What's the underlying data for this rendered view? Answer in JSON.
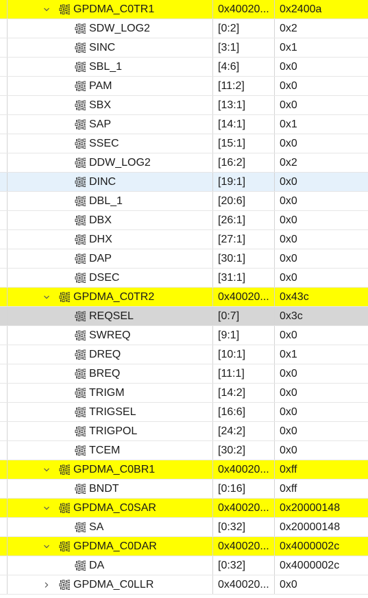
{
  "rows": [
    {
      "type": "reg",
      "name": "GPDMA_C0TR1",
      "addr": "0x40020...",
      "value": "0x2400a",
      "expanded": true,
      "hl": "yellow"
    },
    {
      "type": "field",
      "name": "SDW_LOG2",
      "bits": "[0:2]",
      "value": "0x2"
    },
    {
      "type": "field",
      "name": "SINC",
      "bits": "[3:1]",
      "value": "0x1"
    },
    {
      "type": "field",
      "name": "SBL_1",
      "bits": "[4:6]",
      "value": "0x0"
    },
    {
      "type": "field",
      "name": "PAM",
      "bits": "[11:2]",
      "value": "0x0"
    },
    {
      "type": "field",
      "name": "SBX",
      "bits": "[13:1]",
      "value": "0x0"
    },
    {
      "type": "field",
      "name": "SAP",
      "bits": "[14:1]",
      "value": "0x1"
    },
    {
      "type": "field",
      "name": "SSEC",
      "bits": "[15:1]",
      "value": "0x0"
    },
    {
      "type": "field",
      "name": "DDW_LOG2",
      "bits": "[16:2]",
      "value": "0x2"
    },
    {
      "type": "field",
      "name": "DINC",
      "bits": "[19:1]",
      "value": "0x0",
      "hl": "blue"
    },
    {
      "type": "field",
      "name": "DBL_1",
      "bits": "[20:6]",
      "value": "0x0"
    },
    {
      "type": "field",
      "name": "DBX",
      "bits": "[26:1]",
      "value": "0x0"
    },
    {
      "type": "field",
      "name": "DHX",
      "bits": "[27:1]",
      "value": "0x0"
    },
    {
      "type": "field",
      "name": "DAP",
      "bits": "[30:1]",
      "value": "0x0"
    },
    {
      "type": "field",
      "name": "DSEC",
      "bits": "[31:1]",
      "value": "0x0"
    },
    {
      "type": "reg",
      "name": "GPDMA_C0TR2",
      "addr": "0x40020...",
      "value": "0x43c",
      "expanded": true,
      "hl": "yellow"
    },
    {
      "type": "field",
      "name": "REQSEL",
      "bits": "[0:7]",
      "value": "0x3c",
      "hl": "grey"
    },
    {
      "type": "field",
      "name": "SWREQ",
      "bits": "[9:1]",
      "value": "0x0"
    },
    {
      "type": "field",
      "name": "DREQ",
      "bits": "[10:1]",
      "value": "0x1"
    },
    {
      "type": "field",
      "name": "BREQ",
      "bits": "[11:1]",
      "value": "0x0"
    },
    {
      "type": "field",
      "name": "TRIGM",
      "bits": "[14:2]",
      "value": "0x0"
    },
    {
      "type": "field",
      "name": "TRIGSEL",
      "bits": "[16:6]",
      "value": "0x0"
    },
    {
      "type": "field",
      "name": "TRIGPOL",
      "bits": "[24:2]",
      "value": "0x0"
    },
    {
      "type": "field",
      "name": "TCEM",
      "bits": "[30:2]",
      "value": "0x0"
    },
    {
      "type": "reg",
      "name": "GPDMA_C0BR1",
      "addr": "0x40020...",
      "value": "0xff",
      "expanded": true,
      "hl": "yellow"
    },
    {
      "type": "field",
      "name": "BNDT",
      "bits": "[0:16]",
      "value": "0xff"
    },
    {
      "type": "reg",
      "name": "GPDMA_C0SAR",
      "addr": "0x40020...",
      "value": "0x20000148",
      "expanded": true,
      "hl": "yellow"
    },
    {
      "type": "field",
      "name": "SA",
      "bits": "[0:32]",
      "value": "0x20000148"
    },
    {
      "type": "reg",
      "name": "GPDMA_C0DAR",
      "addr": "0x40020...",
      "value": "0x4000002c",
      "expanded": true,
      "hl": "yellow"
    },
    {
      "type": "field",
      "name": "DA",
      "bits": "[0:32]",
      "value": "0x4000002c"
    },
    {
      "type": "reg",
      "name": "GPDMA_C0LLR",
      "addr": "0x40020...",
      "value": "0x0",
      "expanded": false
    }
  ],
  "icons": {
    "expanded": "chevron-down-icon",
    "collapsed": "chevron-right-icon",
    "register": "binary-register-icon"
  },
  "colors": {
    "highlight_yellow": "#ffff00",
    "selected_blue": "#e5f1fb",
    "selected_grey": "#d6d6d6"
  }
}
